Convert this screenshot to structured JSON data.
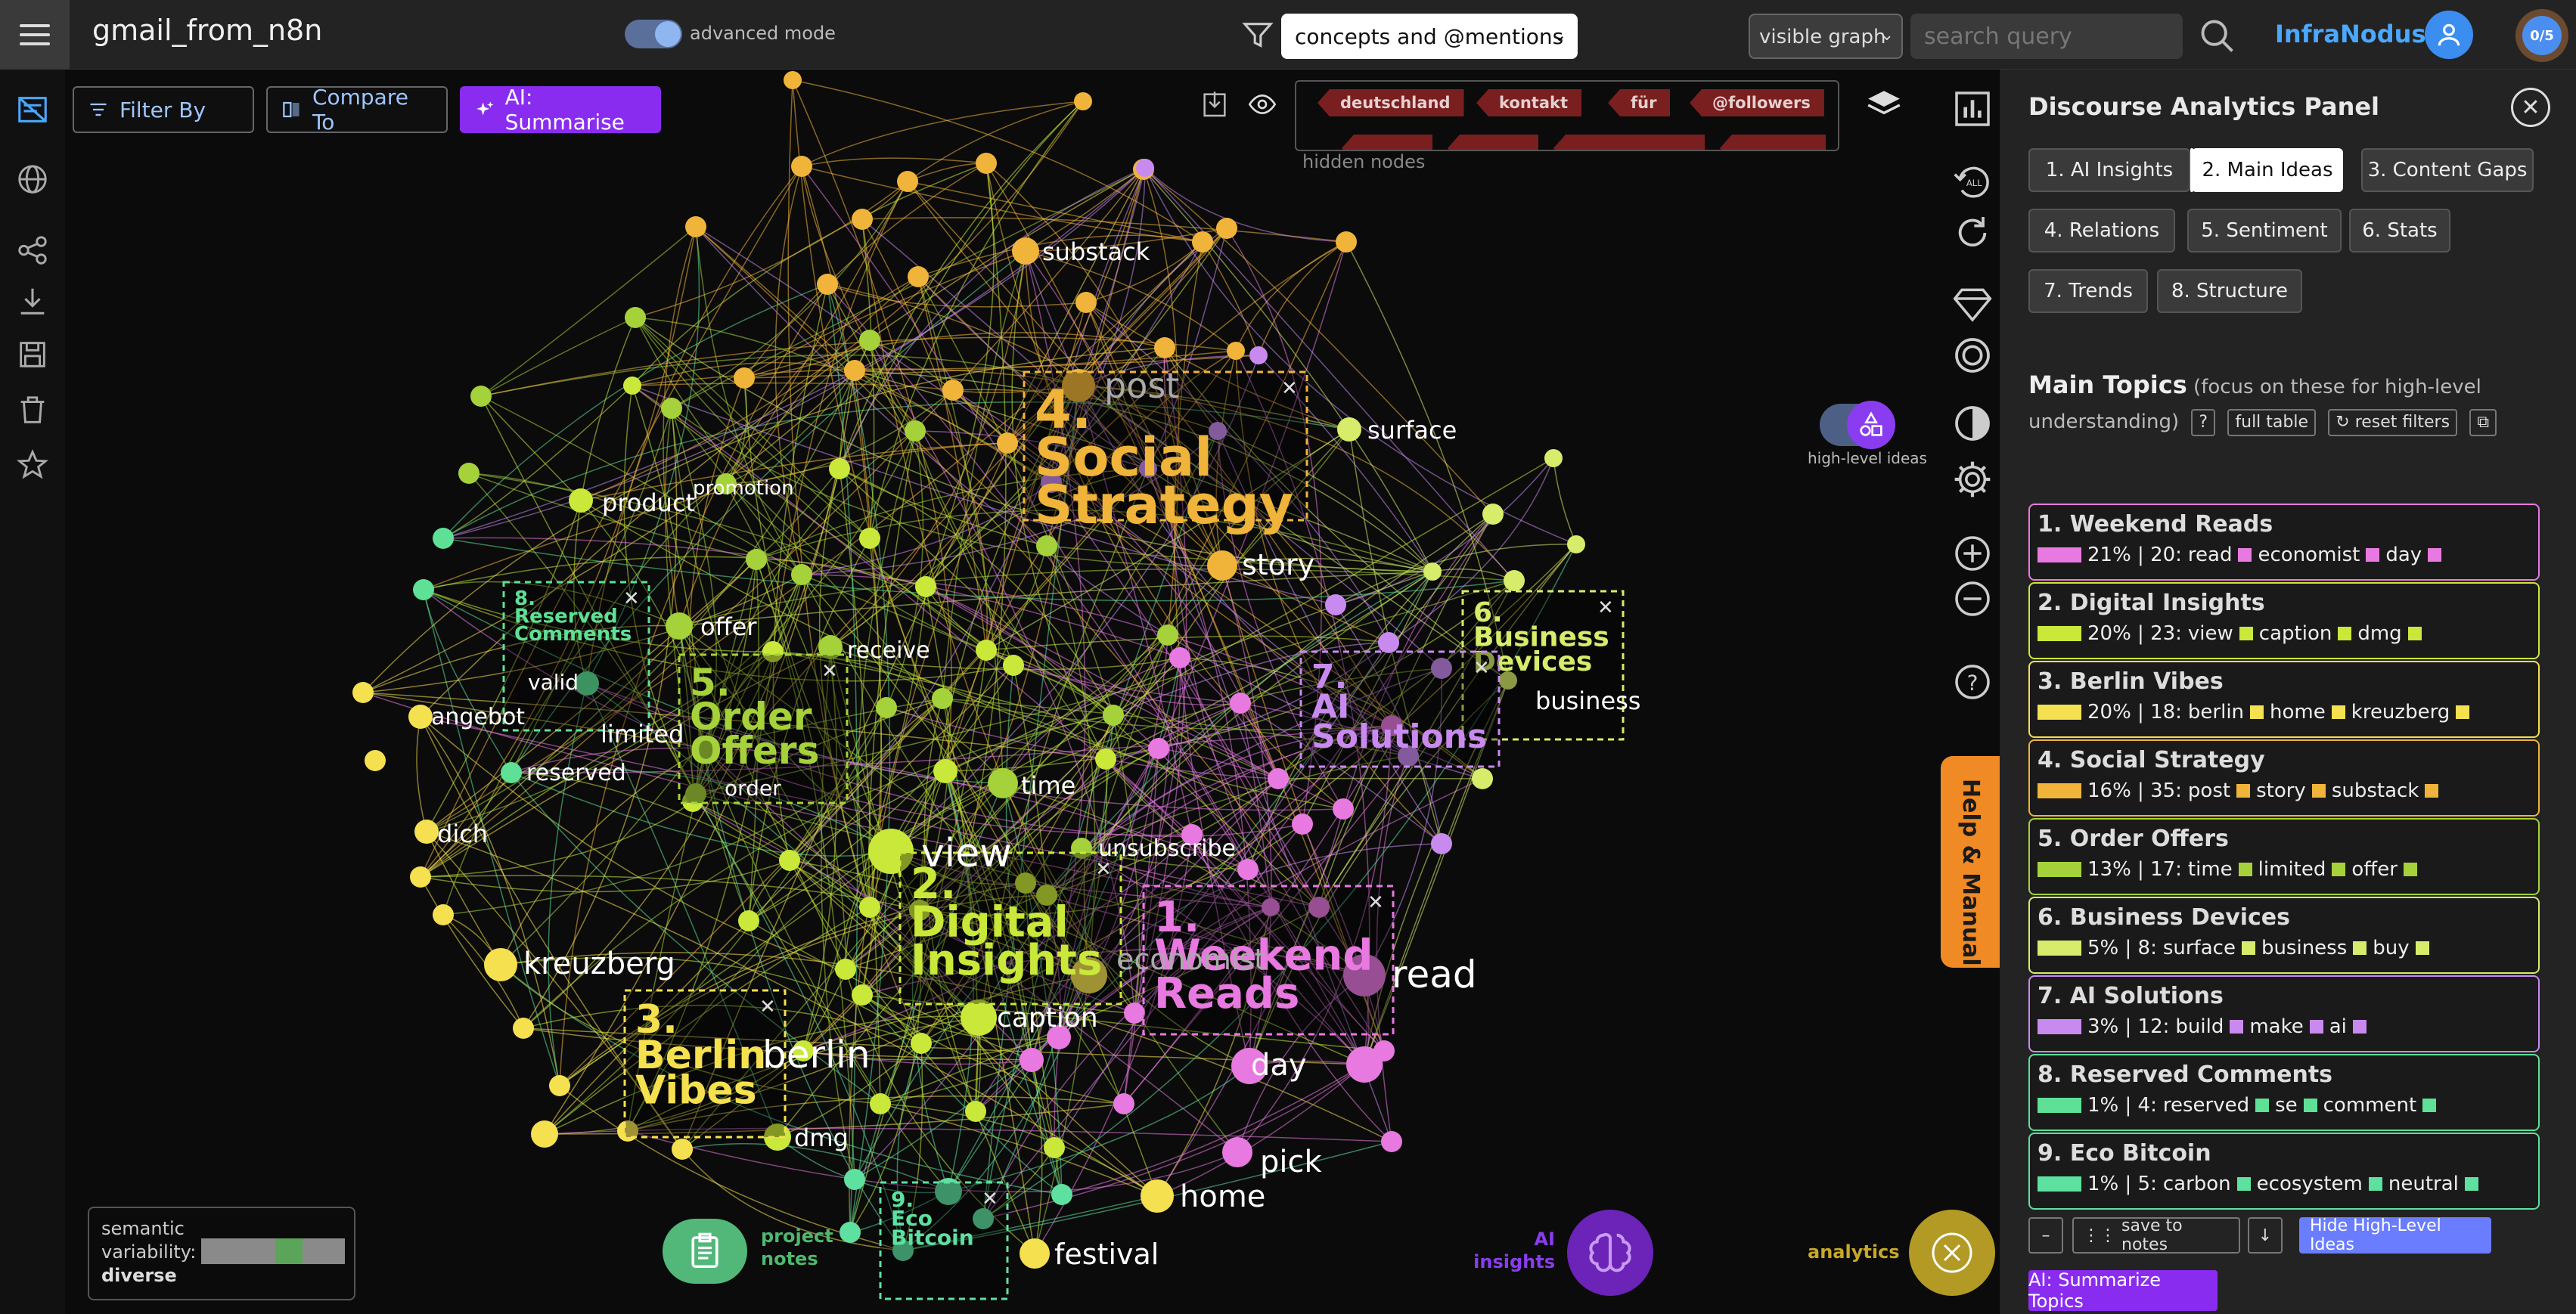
{
  "header": {
    "title": "gmail_from_n8n",
    "advanced_mode_label": "advanced mode",
    "concepts_select": "concepts and @mentions",
    "view_select": "visible graph",
    "search_placeholder": "search query",
    "brand": "InfraNodus",
    "counter": "0/5"
  },
  "toolbar": {
    "filter_label": "Filter By",
    "compare_label": "Compare To",
    "summarise_label": "AI: Summarise"
  },
  "hidden_nodes": {
    "label": "hidden nodes",
    "chips": [
      "deutschland",
      "kontakt",
      "für",
      "@followers"
    ]
  },
  "high_level_ideas_label": "high-level ideas",
  "help_label": "Help & Manual",
  "panel": {
    "title": "Discourse Analytics Panel",
    "tabs": [
      "1. AI Insights",
      "2. Main Ideas",
      "3. Content Gaps",
      "4. Relations",
      "5. Sentiment",
      "6. Stats",
      "7. Trends",
      "8. Structure"
    ],
    "active_tab": "2. Main Ideas",
    "topics_heading": "Main Topics",
    "topics_subtitle": "(focus on these for high-level understanding)",
    "btn_help": "?",
    "btn_full_table": "full table",
    "btn_reset": "↻ reset filters",
    "topics": [
      {
        "title": "1. Weekend Reads",
        "stats": "21% | 20:",
        "words": [
          "read",
          "economist",
          "day"
        ],
        "color": "#e879e0"
      },
      {
        "title": "2. Digital Insights",
        "stats": "20% | 23:",
        "words": [
          "view",
          "caption",
          "dmg"
        ],
        "color": "#c9e83a"
      },
      {
        "title": "3. Berlin Vibes",
        "stats": "20% | 18:",
        "words": [
          "berlin",
          "home",
          "kreuzberg"
        ],
        "color": "#f5e050"
      },
      {
        "title": "4. Social Strategy",
        "stats": "16% | 35:",
        "words": [
          "post",
          "story",
          "substack"
        ],
        "color": "#f0b43a"
      },
      {
        "title": "5. Order Offers",
        "stats": "13% | 17:",
        "words": [
          "time",
          "limited",
          "offer"
        ],
        "color": "#a5d23a"
      },
      {
        "title": "6. Business Devices",
        "stats": "5% | 8:",
        "words": [
          "surface",
          "business",
          "buy"
        ],
        "color": "#d6ec6a"
      },
      {
        "title": "7. AI Solutions",
        "stats": "3% | 12:",
        "words": [
          "build",
          "make",
          "ai"
        ],
        "color": "#c98af0"
      },
      {
        "title": "8. Reserved Comments",
        "stats": "1% | 4:",
        "words": [
          "reserved",
          "se",
          "comment"
        ],
        "color": "#5ee096"
      },
      {
        "title": "9. Eco Bitcoin",
        "stats": "1% | 5:",
        "words": [
          "carbon",
          "ecosystem",
          "neutral"
        ],
        "color": "#5ee0a0"
      }
    ],
    "btn_minus": "–",
    "btn_save_notes": "save to notes",
    "btn_download": "↓",
    "btn_hide_hl": "Hide High-Level Ideas",
    "btn_ai_summarize": "AI: Summarize Topics"
  },
  "graph": {
    "labels": [
      {
        "t": "substack",
        "c": "#ffffff"
      },
      {
        "t": "product",
        "c": "#ffffff"
      },
      {
        "t": "promotion",
        "c": "#ffffff"
      },
      {
        "t": "surface",
        "c": "#ffffff"
      },
      {
        "t": "story",
        "c": "#ffffff"
      },
      {
        "t": "offer",
        "c": "#ffffff"
      },
      {
        "t": "receive",
        "c": "#ffffff"
      },
      {
        "t": "angebot",
        "c": "#ffffff"
      },
      {
        "t": "limited",
        "c": "#ffffff"
      },
      {
        "t": "reserved",
        "c": "#ffffff"
      },
      {
        "t": "valid",
        "c": "#ffffff"
      },
      {
        "t": "dich",
        "c": "#ffffff"
      },
      {
        "t": "time",
        "c": "#ffffff"
      },
      {
        "t": "order",
        "c": "#ffffff"
      },
      {
        "t": "view",
        "c": "#ffffff"
      },
      {
        "t": "unsubscribe",
        "c": "#ffffff"
      },
      {
        "t": "kreuzberg",
        "c": "#ffffff"
      },
      {
        "t": "caption",
        "c": "#ffffff"
      },
      {
        "t": "read",
        "c": "#ffffff"
      },
      {
        "t": "berlin",
        "c": "#ffffff"
      },
      {
        "t": "day",
        "c": "#ffffff"
      },
      {
        "t": "dmg",
        "c": "#ffffff"
      },
      {
        "t": "pick",
        "c": "#ffffff"
      },
      {
        "t": "home",
        "c": "#ffffff"
      },
      {
        "t": "festival",
        "c": "#ffffff"
      },
      {
        "t": "business",
        "c": "#ffffff"
      },
      {
        "t": "post",
        "c": "#ffffff"
      },
      {
        "t": "economist",
        "c": "#ffffff"
      }
    ],
    "clusters": [
      {
        "num": "4.",
        "name": [
          "Social",
          "Strategy"
        ],
        "color": "#f0b43a"
      },
      {
        "num": "2.",
        "name": [
          "Digital",
          "Insights"
        ],
        "color": "#c9e83a"
      },
      {
        "num": "1.",
        "name": [
          "Weekend",
          "Reads"
        ],
        "color": "#e879e0"
      },
      {
        "num": "3.",
        "name": [
          "Berlin",
          "Vibes"
        ],
        "color": "#f5e050"
      },
      {
        "num": "5.",
        "name": [
          "Order",
          "Offers"
        ],
        "color": "#a5d23a"
      },
      {
        "num": "6.",
        "name": [
          "Business",
          "Devices"
        ],
        "color": "#d6ec6a"
      },
      {
        "num": "7.",
        "name": [
          "AI",
          "Solutions"
        ],
        "color": "#c98af0"
      },
      {
        "num": "8.",
        "name": [
          "Reserved",
          "Comments"
        ],
        "color": "#5ee096"
      },
      {
        "num": "9.",
        "name": [
          "Eco",
          "Bitcoin"
        ],
        "color": "#5ee0a0"
      }
    ]
  },
  "bottom": {
    "semantic_label": "semantic variability:",
    "semantic_value": "diverse",
    "notes_label": "project notes",
    "ai_insights_label": "AI insights",
    "analytics_label": "analytics"
  }
}
